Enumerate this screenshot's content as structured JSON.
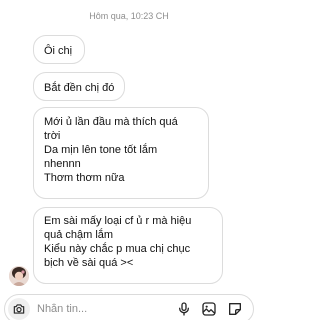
{
  "thread": {
    "timestamp": "Hôm qua, 10:23 CH",
    "messages": [
      {
        "lines": [
          "Ôi chị"
        ]
      },
      {
        "lines": [
          "Bắt đền chị đó"
        ]
      },
      {
        "lines": [
          "Mới ủ lần đầu mà thích quá",
          "trời",
          "Da mịn lên tone tốt lắm",
          "nhennn",
          "Thơm thơm nữa"
        ]
      },
      {
        "lines": [
          "Em sài mấy loại cf ủ r mà hiệu",
          "quả chậm lắm",
          "Kiểu này chắc p mua chị chục",
          "bịch về sài quá ><"
        ]
      }
    ]
  },
  "composer": {
    "placeholder": "Nhắn tin...",
    "value": ""
  },
  "icons": {
    "camera": "camera-icon",
    "mic": "microphone-icon",
    "gallery": "gallery-icon",
    "sticker": "sticker-icon"
  },
  "colors": {
    "bubble_border": "#dcdcdc",
    "camera_bg": "#efefef",
    "timestamp": "#8e8e8e"
  }
}
